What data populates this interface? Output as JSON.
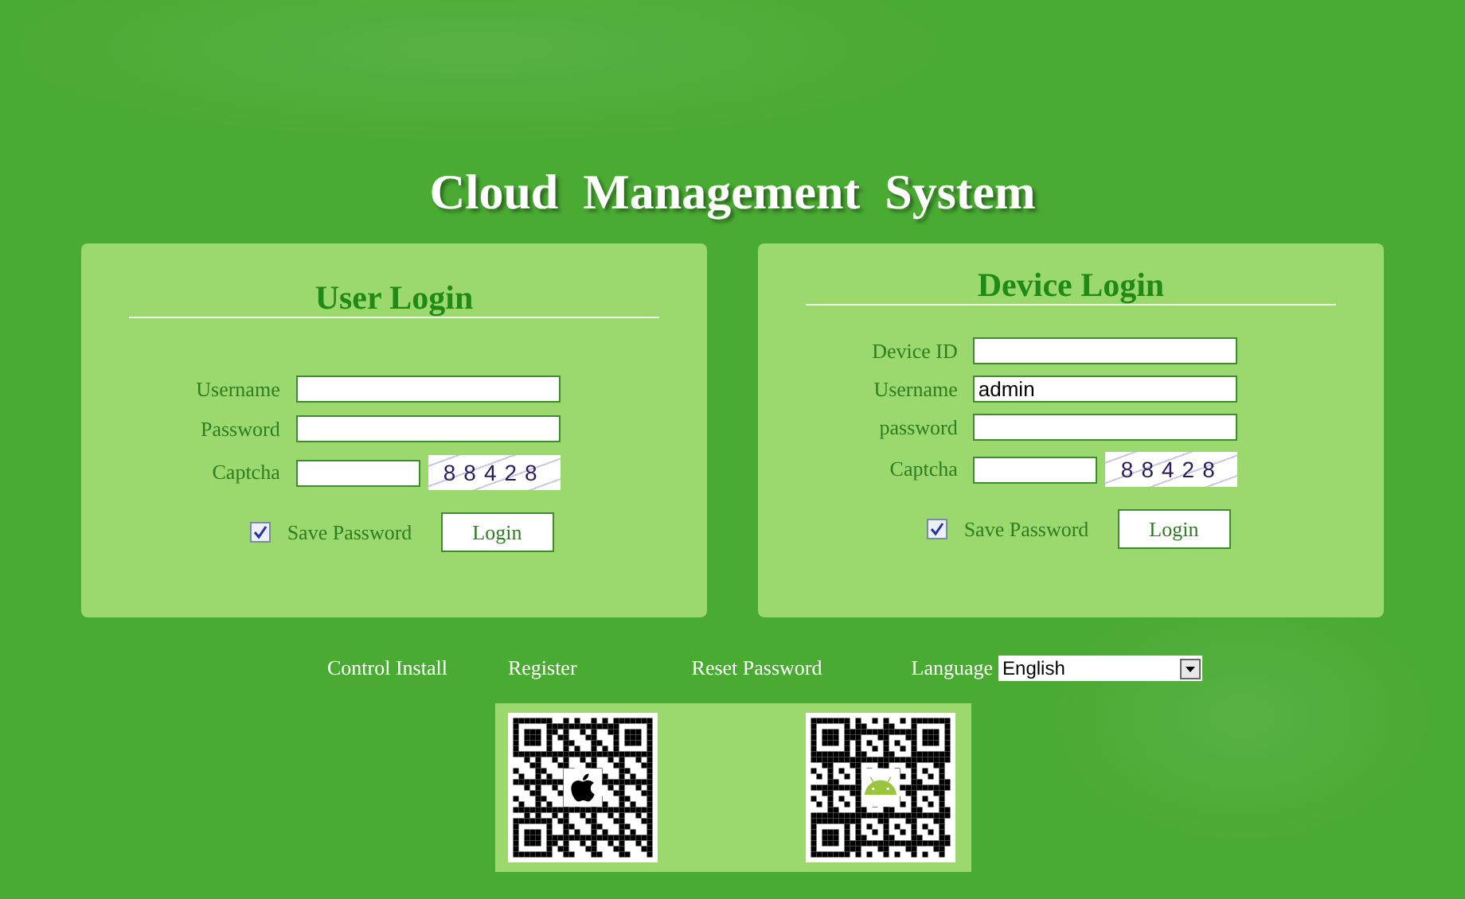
{
  "title": "Cloud  Management  System",
  "panels": [
    {
      "heading": "User Login",
      "fields": [
        {
          "kind": "text",
          "label": "Username"
        },
        {
          "kind": "text",
          "label": "Password"
        },
        {
          "kind": "captcha",
          "label": "Captcha",
          "captcha": "88428"
        }
      ],
      "save_password": {
        "label": "Save Password",
        "checked": true
      },
      "button": "Login"
    },
    {
      "heading": "Device Login",
      "fields": [
        {
          "kind": "text",
          "label": "Device ID"
        },
        {
          "kind": "text",
          "label": "Username",
          "value": "admin"
        },
        {
          "kind": "text",
          "label": "password"
        },
        {
          "kind": "captcha",
          "label": "Captcha",
          "captcha": "88428"
        }
      ],
      "save_password": {
        "label": "Save Password",
        "checked": true
      },
      "button": "Login"
    }
  ],
  "links": [
    "Control Install",
    "Register",
    "Reset Password"
  ],
  "language": {
    "label": "Language",
    "value": "English"
  },
  "qr_codes": [
    {
      "kind": "apple"
    },
    {
      "kind": "android"
    }
  ]
}
